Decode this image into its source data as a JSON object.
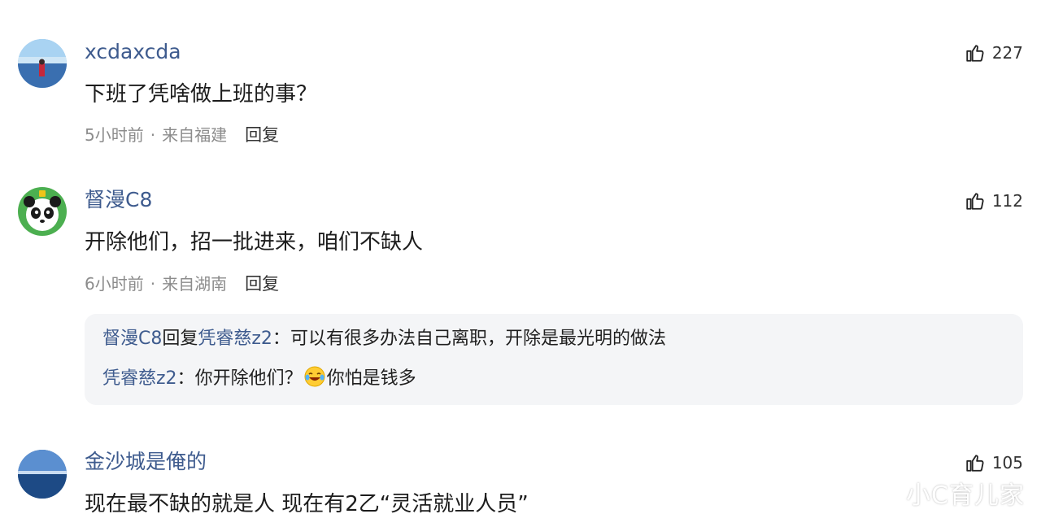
{
  "comments": [
    {
      "username": "xcdaxcda",
      "content": "下班了凭啥做上班的事？",
      "time": "5小时前",
      "location": "来自福建",
      "reply_label": "回复",
      "likes": "227",
      "avatar_icon": "landscape-avatar"
    },
    {
      "username": "督漫C8",
      "content": "开除他们，招一批进来，咱们不缺人",
      "time": "6小时前",
      "location": "来自湖南",
      "reply_label": "回复",
      "likes": "112",
      "avatar_icon": "panda-avatar",
      "replies": [
        {
          "author": "督漫C8",
          "reply_word": "回复",
          "target": "凭睿慈z2",
          "colon": "：",
          "text": "可以有很多办法自己离职，开除是最光明的做法"
        },
        {
          "author": "凭睿慈z2",
          "colon": "：",
          "text_before": "你开除他们？",
          "emoji": "laughing-tears-emoji",
          "text_after": "你怕是钱多"
        }
      ]
    },
    {
      "username": "金沙城是俺的",
      "content": "现在最不缺的就是人 现在有2乙“灵活就业人员”",
      "likes": "105",
      "avatar_icon": "lake-avatar"
    }
  ],
  "separator": "·",
  "watermark": "小C育儿家",
  "colors": {
    "username": "#3e5b8e",
    "meta": "#8c8c8c",
    "reply_bg": "#f4f5f7"
  }
}
